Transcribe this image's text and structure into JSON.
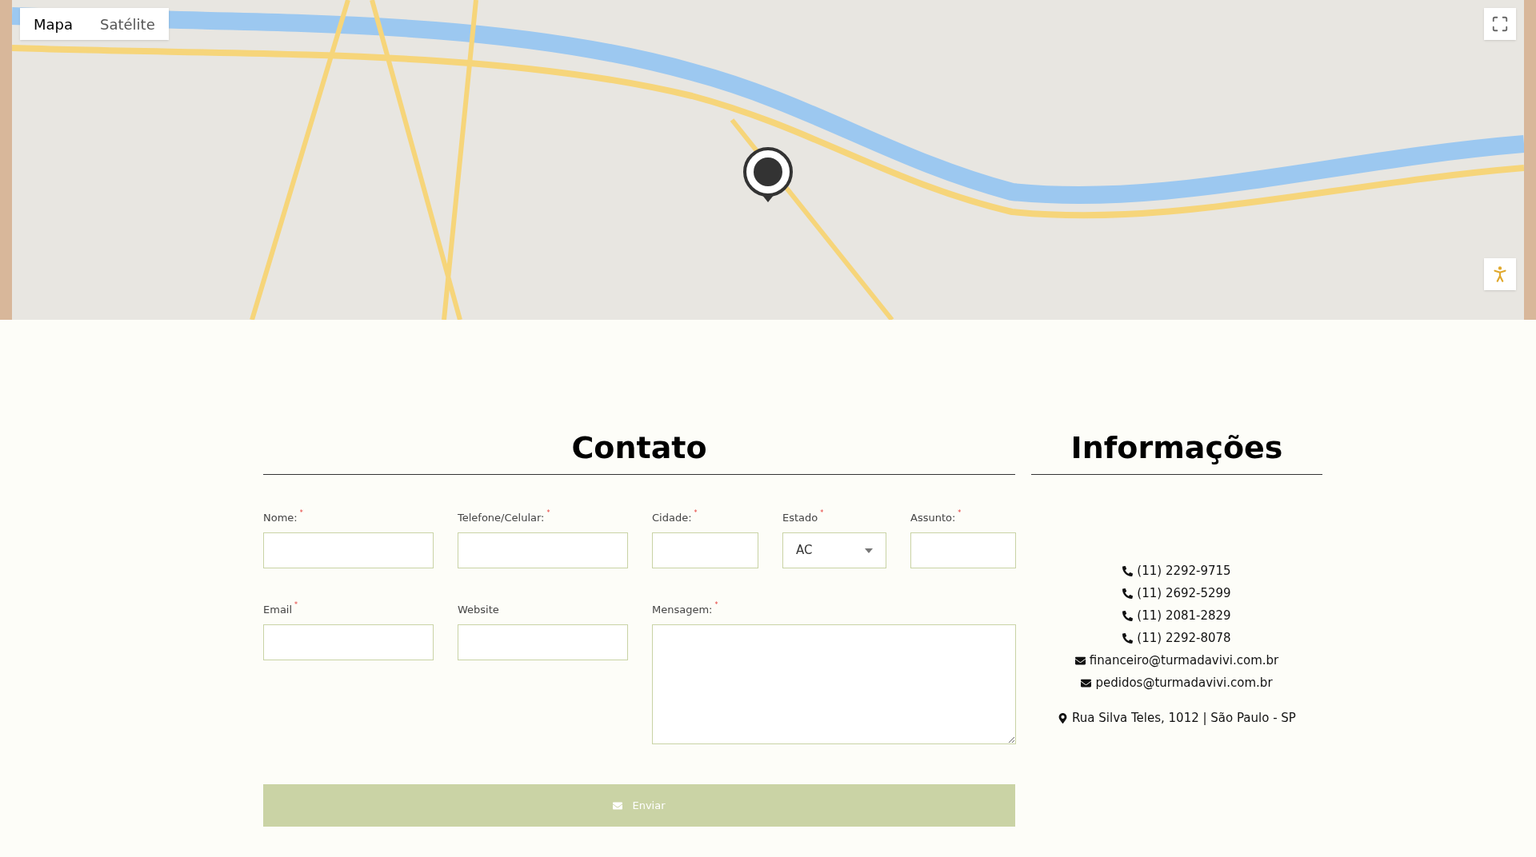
{
  "map": {
    "types": [
      {
        "label": "Mapa",
        "selected": true
      },
      {
        "label": "Satélite",
        "selected": false
      }
    ]
  },
  "contact": {
    "title": "Contato",
    "fields": [
      {
        "label": "Nome:",
        "required_mark": "*",
        "kind": "input"
      },
      {
        "label": "Telefone/Celular:",
        "required_mark": "*",
        "kind": "input"
      },
      {
        "label": "Cidade:",
        "required_mark": "*",
        "kind": "input"
      },
      {
        "label": "Estado",
        "required_mark": "*",
        "kind": "select",
        "value": "AC"
      },
      {
        "label": "Assunto:",
        "required_mark": "*",
        "kind": "input"
      },
      {
        "label": "Email",
        "required_mark": "*",
        "kind": "input"
      },
      {
        "label": "Website",
        "kind": "input"
      },
      {
        "label": "Mensagem:",
        "required_mark": "*",
        "kind": "textarea"
      }
    ],
    "submit": "Enviar"
  },
  "info": {
    "title": "Informações",
    "items": [
      {
        "kind": "phone",
        "text": "(11) 2292-9715"
      },
      {
        "kind": "phone",
        "text": "(11) 2692-5299"
      },
      {
        "kind": "phone",
        "text": "(11) 2081-2829"
      },
      {
        "kind": "phone",
        "text": "(11) 2292-8078"
      },
      {
        "kind": "email",
        "text": "financeiro@turmadavivi.com.br"
      },
      {
        "kind": "email",
        "text": "pedidos@turmadavivi.com.br"
      },
      {
        "kind": "address",
        "text": "Rua Silva Teles, 1012 | São Paulo - SP"
      }
    ]
  }
}
